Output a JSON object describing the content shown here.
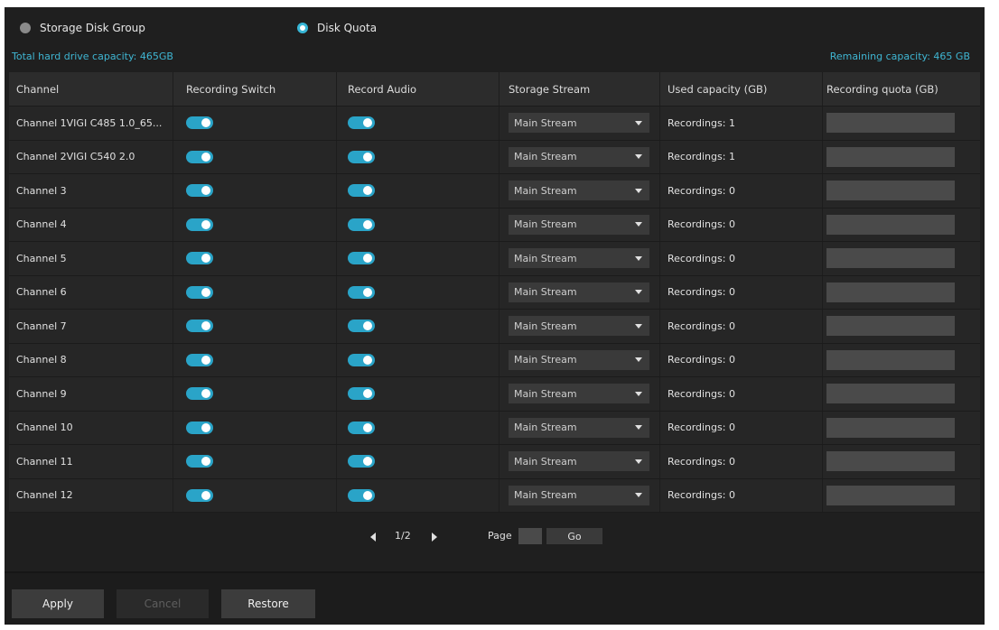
{
  "modes": [
    {
      "label": "Storage Disk Group",
      "selected": false
    },
    {
      "label": "Disk Quota",
      "selected": true
    }
  ],
  "capacity": {
    "total": "Total hard drive capacity: 465GB",
    "remaining": "Remaining capacity: 465 GB"
  },
  "columns": [
    "Channel",
    "Recording Switch",
    "Record Audio",
    "Storage Stream",
    "Used capacity (GB)",
    "Recording quota (GB)"
  ],
  "rows": [
    {
      "channel": "Channel 1VIGI C485 1.0_65...",
      "recording_switch": true,
      "record_audio": true,
      "stream": "Main Stream",
      "used": "Recordings: 1",
      "quota": ""
    },
    {
      "channel": "Channel 2VIGI C540 2.0",
      "recording_switch": true,
      "record_audio": true,
      "stream": "Main Stream",
      "used": "Recordings: 1",
      "quota": ""
    },
    {
      "channel": "Channel 3",
      "recording_switch": true,
      "record_audio": true,
      "stream": "Main Stream",
      "used": "Recordings: 0",
      "quota": ""
    },
    {
      "channel": "Channel 4",
      "recording_switch": true,
      "record_audio": true,
      "stream": "Main Stream",
      "used": "Recordings: 0",
      "quota": ""
    },
    {
      "channel": "Channel 5",
      "recording_switch": true,
      "record_audio": true,
      "stream": "Main Stream",
      "used": "Recordings: 0",
      "quota": ""
    },
    {
      "channel": "Channel 6",
      "recording_switch": true,
      "record_audio": true,
      "stream": "Main Stream",
      "used": "Recordings: 0",
      "quota": ""
    },
    {
      "channel": "Channel 7",
      "recording_switch": true,
      "record_audio": true,
      "stream": "Main Stream",
      "used": "Recordings: 0",
      "quota": ""
    },
    {
      "channel": "Channel 8",
      "recording_switch": true,
      "record_audio": true,
      "stream": "Main Stream",
      "used": "Recordings: 0",
      "quota": ""
    },
    {
      "channel": "Channel 9",
      "recording_switch": true,
      "record_audio": true,
      "stream": "Main Stream",
      "used": "Recordings: 0",
      "quota": ""
    },
    {
      "channel": "Channel 10",
      "recording_switch": true,
      "record_audio": true,
      "stream": "Main Stream",
      "used": "Recordings: 0",
      "quota": ""
    },
    {
      "channel": "Channel 11",
      "recording_switch": true,
      "record_audio": true,
      "stream": "Main Stream",
      "used": "Recordings: 0",
      "quota": ""
    },
    {
      "channel": "Channel 12",
      "recording_switch": true,
      "record_audio": true,
      "stream": "Main Stream",
      "used": "Recordings: 0",
      "quota": ""
    }
  ],
  "pagination": {
    "indicator": "1/2",
    "page_label": "Page",
    "page_value": "",
    "go_label": "Go"
  },
  "buttons": {
    "apply": "Apply",
    "cancel": "Cancel",
    "restore": "Restore"
  },
  "colors": {
    "accent": "#2aa4c8",
    "capacity_text": "#3fb6d3",
    "background": "#1f1f1f"
  },
  "icons": {
    "prev": "caret-left-icon",
    "next": "caret-right-icon",
    "dropdown": "caret-down-icon"
  }
}
